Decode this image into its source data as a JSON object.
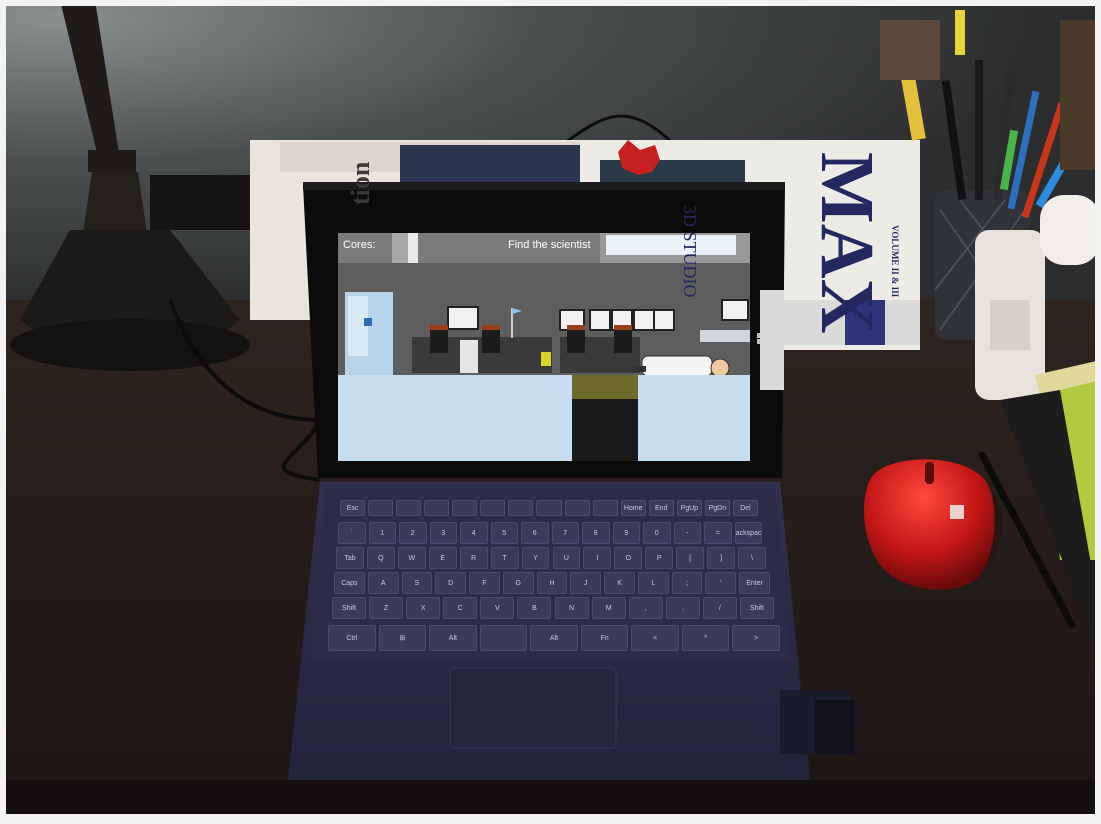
{
  "game": {
    "hud_cores_label": "Cores:",
    "objective": "Find the scientist"
  },
  "book": {
    "spine_title": "3D STUDIO",
    "spine_big": "MAX",
    "spine_volume": "VOLUME II & III",
    "side_text": "tion"
  },
  "keyboard": {
    "rows": [
      [
        "Esc",
        "",
        "",
        "",
        "",
        "",
        "",
        "",
        "",
        "",
        "Home",
        "End",
        "PgUp",
        "PgDn",
        "Del"
      ],
      [
        "`",
        "1",
        "2",
        "3",
        "4",
        "5",
        "6",
        "7",
        "8",
        "9",
        "0",
        "-",
        "=",
        "Backspace"
      ],
      [
        "Tab",
        "Q",
        "W",
        "E",
        "R",
        "T",
        "Y",
        "U",
        "I",
        "O",
        "P",
        "[",
        "]",
        "\\"
      ],
      [
        "Caps",
        "A",
        "S",
        "D",
        "F",
        "G",
        "H",
        "J",
        "K",
        "L",
        ";",
        "'",
        "Enter"
      ],
      [
        "Shift",
        "Z",
        "X",
        "C",
        "V",
        "B",
        "N",
        "M",
        ",",
        ".",
        "/",
        "Shift"
      ],
      [
        "Ctrl",
        "⊞",
        "Alt",
        "",
        "Alt",
        "Fn",
        "<",
        "^",
        ">"
      ]
    ]
  },
  "colors": {
    "wall": "#3a3c3c",
    "desk": "#221b18",
    "tablet_cover": "#2b2b4a",
    "screen_sky": "#8a8a8a",
    "screen_floor": "#c9ddf0",
    "mouse": "#c81818"
  },
  "icons": {
    "windows_logo": "windows-icon",
    "mouse": "mouse-icon"
  }
}
